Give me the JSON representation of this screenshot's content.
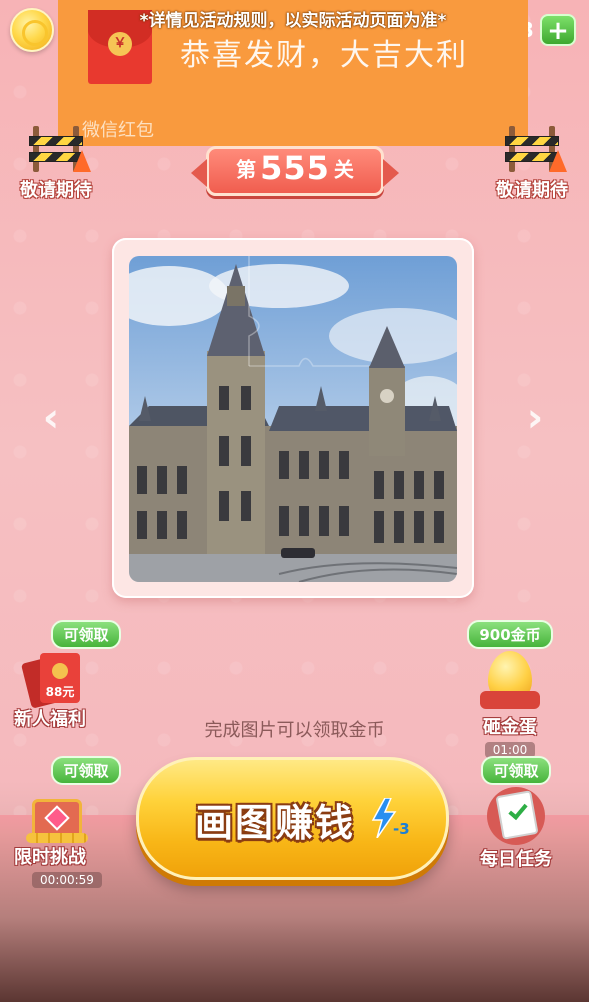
{
  "banner": {
    "rule_text": "*详情见活动规则，以实际活动页面为准*",
    "title": "恭喜发财，大吉大利",
    "source": "微信红包",
    "envelope_symbol": "￥"
  },
  "topbar": {
    "coin_icon": "gold-coin-icon",
    "balance_tail": "3",
    "plus_label": "+"
  },
  "level": {
    "prefix": "第",
    "number": "555",
    "suffix": "关"
  },
  "coming_soon": {
    "left_label": "敬请期待",
    "right_label": "敬请期待"
  },
  "nav": {
    "prev_glyph": "‹",
    "next_glyph": "›"
  },
  "puzzle": {
    "image_subject": "gothic-building-photo"
  },
  "hint": "完成图片可以领取金币",
  "features": {
    "newbie": {
      "tag": "可领取",
      "label": "新人福利",
      "amount": "88元"
    },
    "egg": {
      "tag": "900金币",
      "label": "砸金蛋",
      "timer": "01:00"
    },
    "challenge": {
      "tag": "可领取",
      "label": "限时挑战",
      "timer": "00:00:59"
    },
    "daily": {
      "tag": "可领取",
      "label": "每日任务"
    }
  },
  "main_button": {
    "label": "画图赚钱",
    "cost": "-3",
    "icon": "lightning-bolt-icon"
  },
  "colors": {
    "banner_orange": "#f99a3e",
    "badge_red": "#f05d4f",
    "tag_green": "#47b43b",
    "button_yellow": "#ffd23a"
  }
}
